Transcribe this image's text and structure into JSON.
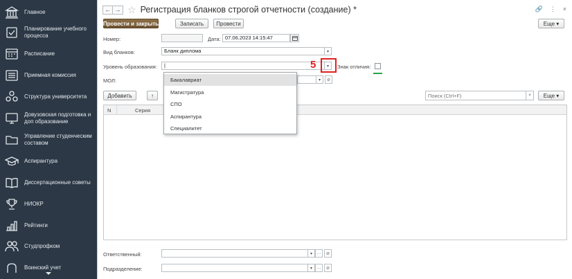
{
  "sidebar": {
    "items": [
      {
        "label": "Главное",
        "icon": "bank-icon"
      },
      {
        "label": "Планирование учебного процесса",
        "icon": "calendar-check-icon"
      },
      {
        "label": "Расписание",
        "icon": "schedule-icon"
      },
      {
        "label": "Приемная комиссия",
        "icon": "list-icon"
      },
      {
        "label": "Структура университета",
        "icon": "structure-icon"
      },
      {
        "label": "Довузовская подготовка и доп образование",
        "icon": "monitor-icon"
      },
      {
        "label": "Управление студенческим составом",
        "icon": "folder-icon"
      },
      {
        "label": "Аспирантура",
        "icon": "graduation-cap-icon"
      },
      {
        "label": "Диссертационные советы",
        "icon": "book-icon"
      },
      {
        "label": "НИОКР",
        "icon": "trophy-icon"
      },
      {
        "label": "Рейтинги",
        "icon": "bar-chart-icon"
      },
      {
        "label": "Студпрофком",
        "icon": "people-icon"
      },
      {
        "label": "Воинский учет",
        "icon": "military-icon"
      }
    ]
  },
  "header": {
    "back": "←",
    "forward": "→",
    "star": "☆",
    "title": "Регистрация бланков строгой отчетности (создание) *",
    "link_icon": "🔗",
    "more_icon": "⋮",
    "close_icon": "×"
  },
  "toolbar": {
    "post_close": "Провести и закрыть",
    "save": "Записать",
    "post": "Провести",
    "more": "Еще ▾"
  },
  "form": {
    "number_label": "Номер:",
    "number_value": "",
    "date_label": "Дата:",
    "date_value": "07.06.2023 14:15:47",
    "blank_type_label": "Вид бланков:",
    "blank_type_value": "Бланк диплома",
    "edu_level_label": "Уровень образования:",
    "edu_level_value": "|",
    "distinction_label": "Знак отличия:",
    "mol_label": "МОЛ:",
    "mol_value": "",
    "responsible_label": "Ответственный:",
    "responsible_value": "",
    "division_label": "Подразделение:",
    "division_value": ""
  },
  "table_toolbar": {
    "add": "Добавить",
    "up": "↑",
    "search_placeholder": "Поиск (Ctrl+F)",
    "more": "Еще ▾"
  },
  "table": {
    "columns": [
      "N",
      "Серия"
    ]
  },
  "dropdown": {
    "options": [
      "Бакалавриат",
      "Магистратура",
      "СПО",
      "Аспирантура",
      "Специалитет"
    ],
    "selected_index": 0
  },
  "annotation": {
    "number": "5"
  },
  "colors": {
    "sidebar_bg": "#2c3845",
    "primary_button": "#7a5c37",
    "annotation_red": "#e02020",
    "annotation_green": "#27a745"
  }
}
